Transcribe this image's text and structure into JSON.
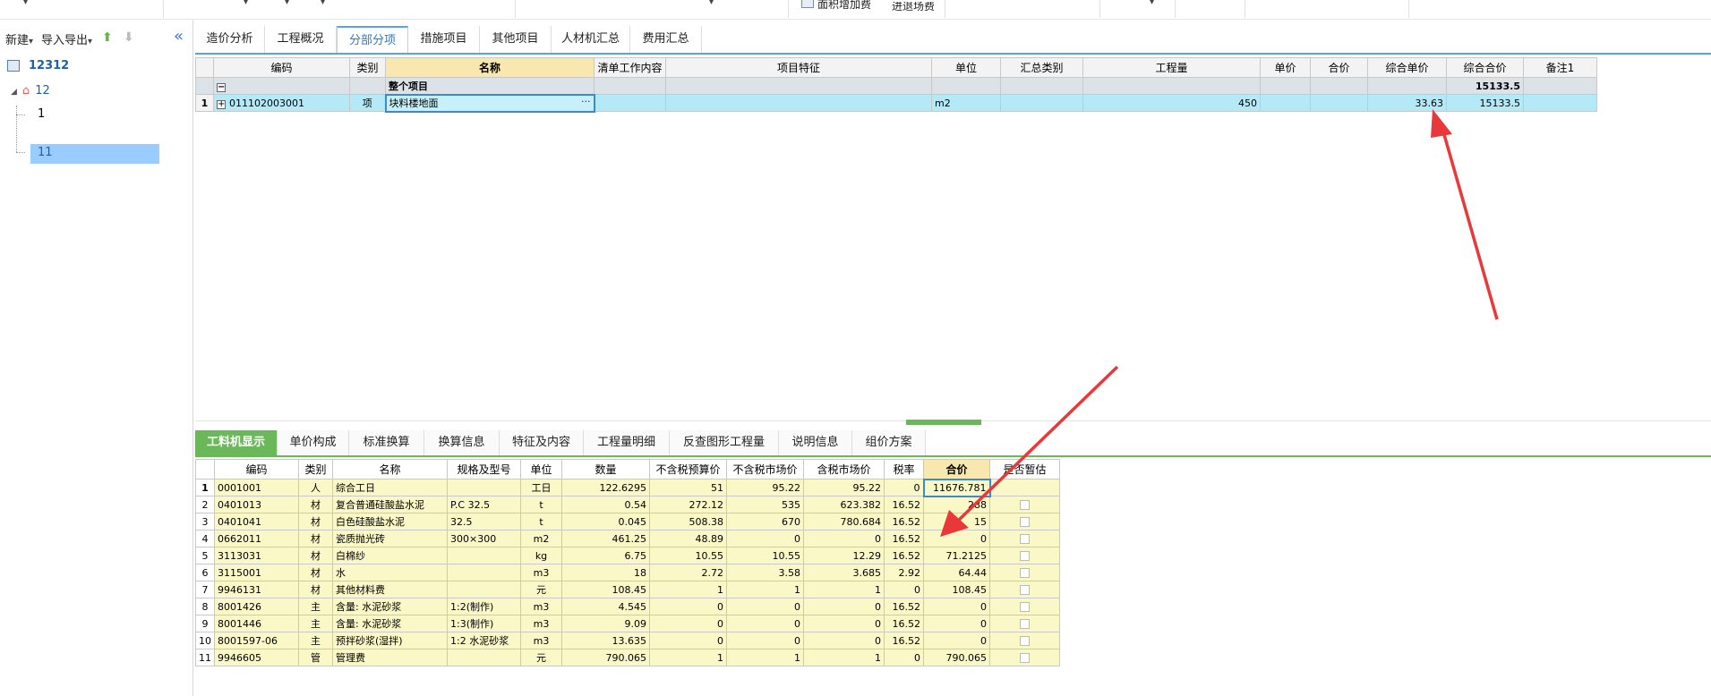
{
  "toolbar": {
    "area_fee": "面积增加费",
    "entry_exit_fee": "进退场费"
  },
  "sidebar": {
    "new_label": "新建",
    "import_export_label": "导入导出",
    "tree": {
      "root": "12312",
      "child": "12",
      "leaf1": "1",
      "leaf2": "11"
    }
  },
  "main_tabs": [
    "造价分析",
    "工程概况",
    "分部分项",
    "措施项目",
    "其他项目",
    "人材机汇总",
    "费用汇总"
  ],
  "active_main_tab": "分部分项",
  "grid1": {
    "headers": [
      "编码",
      "类别",
      "名称",
      "清单工作内容",
      "项目特征",
      "单位",
      "汇总类别",
      "工程量",
      "单价",
      "合价",
      "综合单价",
      "综合合价",
      "备注1"
    ],
    "group_row": {
      "name": "整个项目",
      "total": "15133.5",
      "toggle": "−"
    },
    "rows": [
      {
        "no": "1",
        "toggle": "+",
        "code": "011102003001",
        "type": "项",
        "name": "块料楼地面",
        "ellipsis": "···",
        "unit": "m2",
        "qty": "450",
        "unit_price": "33.63",
        "total": "15133.5"
      }
    ]
  },
  "sub_tabs": [
    "工料机显示",
    "单价构成",
    "标准换算",
    "换算信息",
    "特征及内容",
    "工程量明细",
    "反查图形工程量",
    "说明信息",
    "组价方案"
  ],
  "active_sub_tab": "工料机显示",
  "grid2": {
    "headers": [
      "编码",
      "类别",
      "名称",
      "规格及型号",
      "单位",
      "数量",
      "不含税预算价",
      "不含税市场价",
      "含税市场价",
      "税率",
      "合价",
      "是否暂估"
    ],
    "rows": [
      {
        "no": "1",
        "code": "0001001",
        "type": "人",
        "name": "综合工日",
        "spec": "",
        "unit": "工日",
        "qty": "122.6295",
        "p1": "51",
        "p2": "95.22",
        "p3": "95.22",
        "tax": "0",
        "total": "11676.781"
      },
      {
        "no": "2",
        "code": "0401013",
        "type": "材",
        "name": "复合普通硅酸盐水泥",
        "spec": "P.C 32.5",
        "unit": "t",
        "qty": "0.54",
        "p1": "272.12",
        "p2": "535",
        "p3": "623.382",
        "tax": "16.52",
        "total": "288"
      },
      {
        "no": "3",
        "code": "0401041",
        "type": "材",
        "name": "白色硅酸盐水泥",
        "spec": "32.5",
        "unit": "t",
        "qty": "0.045",
        "p1": "508.38",
        "p2": "670",
        "p3": "780.684",
        "tax": "16.52",
        "total": "15"
      },
      {
        "no": "4",
        "code": "0662011",
        "type": "材",
        "name": "瓷质抛光砖",
        "spec": "300×300",
        "unit": "m2",
        "qty": "461.25",
        "p1": "48.89",
        "p2": "0",
        "p3": "0",
        "tax": "16.52",
        "total": "0"
      },
      {
        "no": "5",
        "code": "3113031",
        "type": "材",
        "name": "白棉纱",
        "spec": "",
        "unit": "kg",
        "qty": "6.75",
        "p1": "10.55",
        "p2": "10.55",
        "p3": "12.29",
        "tax": "16.52",
        "total": "71.2125"
      },
      {
        "no": "6",
        "code": "3115001",
        "type": "材",
        "name": "水",
        "spec": "",
        "unit": "m3",
        "qty": "18",
        "p1": "2.72",
        "p2": "3.58",
        "p3": "3.685",
        "tax": "2.92",
        "total": "64.44"
      },
      {
        "no": "7",
        "code": "9946131",
        "type": "材",
        "name": "其他材料费",
        "spec": "",
        "unit": "元",
        "qty": "108.45",
        "p1": "1",
        "p2": "1",
        "p3": "1",
        "tax": "0",
        "total": "108.45"
      },
      {
        "no": "8",
        "code": "8001426",
        "type": "主",
        "name": "含量: 水泥砂浆",
        "spec": "1:2(制作)",
        "unit": "m3",
        "qty": "4.545",
        "p1": "0",
        "p2": "0",
        "p3": "0",
        "tax": "16.52",
        "total": "0"
      },
      {
        "no": "9",
        "code": "8001446",
        "type": "主",
        "name": "含量: 水泥砂浆",
        "spec": "1:3(制作)",
        "unit": "m3",
        "qty": "9.09",
        "p1": "0",
        "p2": "0",
        "p3": "0",
        "tax": "16.52",
        "total": "0"
      },
      {
        "no": "10",
        "code": "8001597-06",
        "type": "主",
        "name": "预拌砂浆(湿拌)",
        "spec": "1:2 水泥砂浆",
        "unit": "m3",
        "qty": "13.635",
        "p1": "0",
        "p2": "0",
        "p3": "0",
        "tax": "16.52",
        "total": "0"
      },
      {
        "no": "11",
        "code": "9946605",
        "type": "管",
        "name": "管理费",
        "spec": "",
        "unit": "元",
        "qty": "790.065",
        "p1": "1",
        "p2": "1",
        "p3": "1",
        "tax": "0",
        "total": "790.065"
      }
    ]
  },
  "colors": {
    "accent_blue": "#5aa3e0",
    "accent_green": "#6ab85a",
    "arrow_red": "#e8383a"
  }
}
